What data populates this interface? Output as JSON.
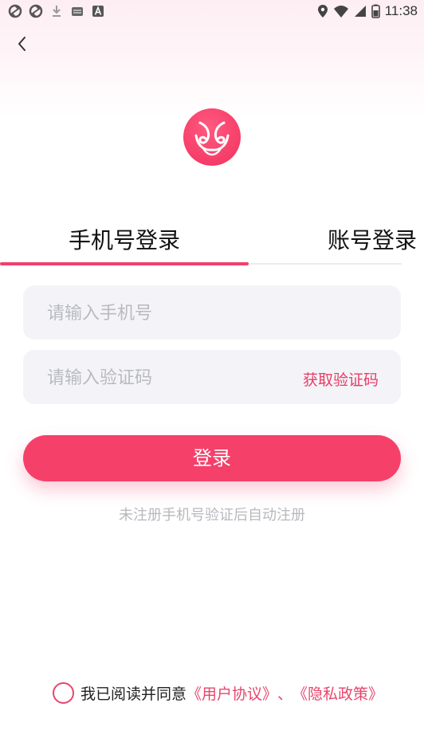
{
  "status_bar": {
    "time": "11:38",
    "left_icons": [
      "sync-icon",
      "sync-icon",
      "download-icon",
      "mail-icon",
      "app-a-icon"
    ],
    "right_icons": [
      "location-icon",
      "wifi-icon",
      "signal-icon",
      "battery-icon"
    ]
  },
  "nav": {
    "back_icon": "chevron-left-icon"
  },
  "logo": {
    "icon": "swan-logo-icon",
    "color": "#f0315e"
  },
  "tabs": [
    {
      "label": "手机号登录",
      "active": true
    },
    {
      "label": "账号登录",
      "active": false
    }
  ],
  "form": {
    "phone_placeholder": "请输入手机号",
    "phone_value": "",
    "code_placeholder": "请输入验证码",
    "code_value": "",
    "get_code_label": "获取验证码"
  },
  "login_button": {
    "label": "登录"
  },
  "register_hint": "未注册手机号验证后自动注册",
  "agreement": {
    "prefix": "我已阅读并同意",
    "user_agreement": "《用户协议》",
    "separator": "、",
    "privacy_policy": "《隐私政策》",
    "checked": false
  },
  "colors": {
    "accent": "#f5406a",
    "link": "#e8456d",
    "input_bg": "#f4f4f8"
  }
}
